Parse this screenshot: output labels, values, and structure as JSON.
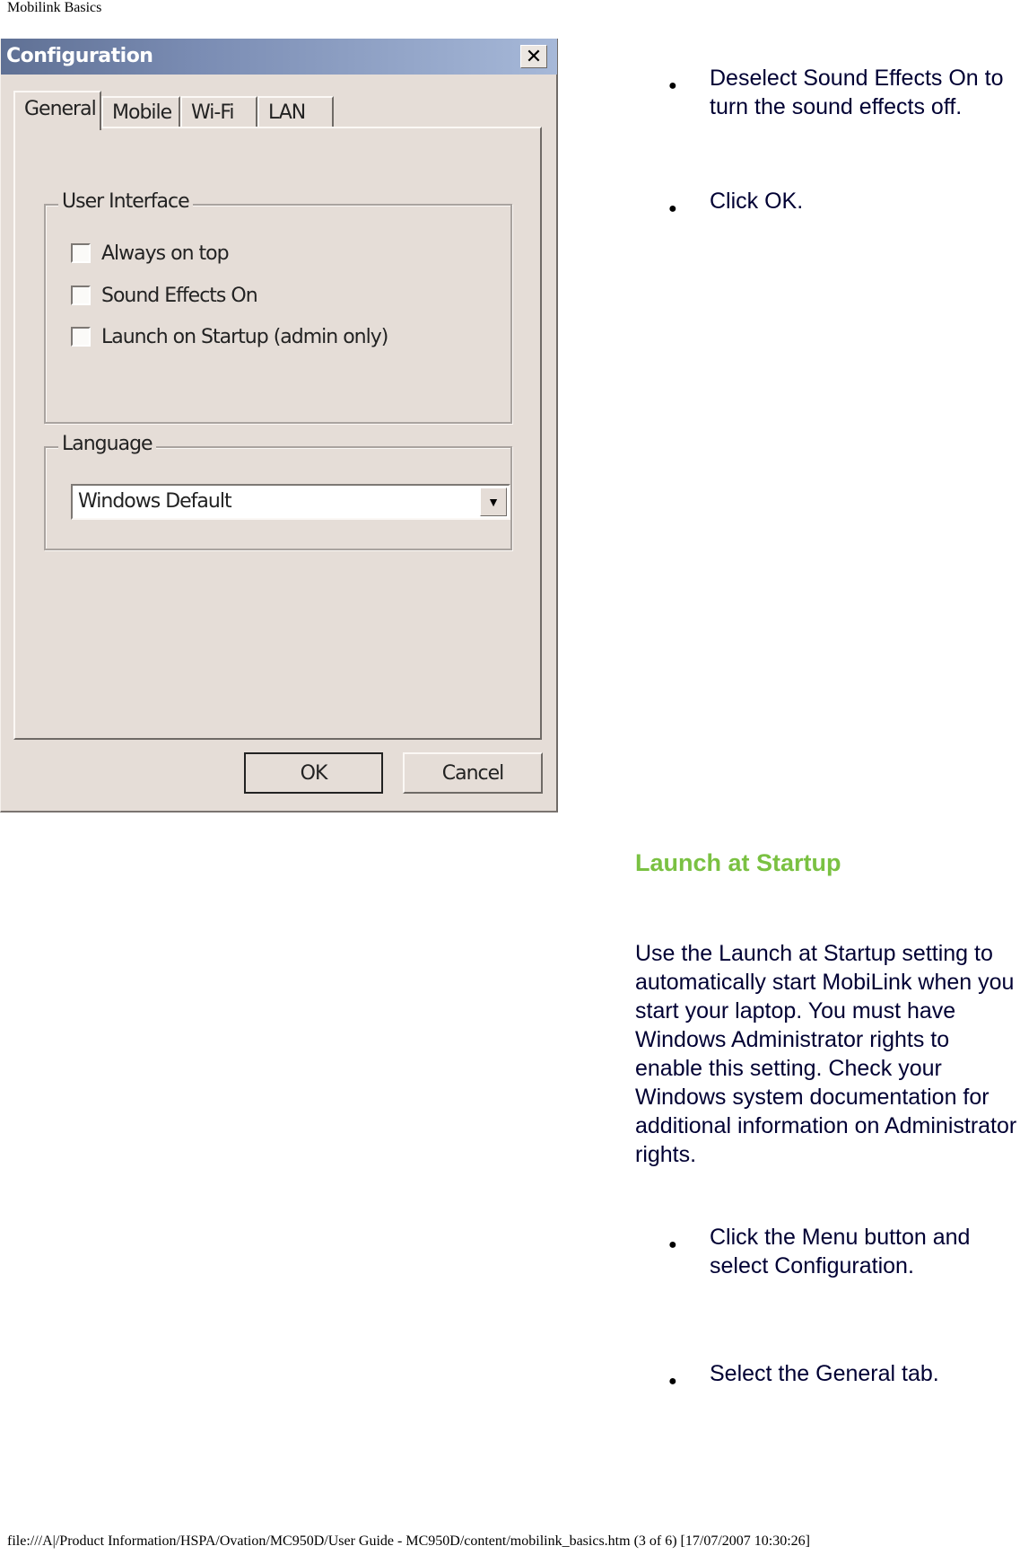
{
  "page": {
    "header": "Mobilink Basics",
    "footer": "file:///A|/Product Information/HSPA/Ovation/MC950D/User Guide - MC950D/content/mobilink_basics.htm (3 of 6) [17/07/2007 10:30:26]"
  },
  "dialog": {
    "title": "Configuration",
    "close_icon": "✕",
    "tabs": [
      {
        "label": "General",
        "active": true
      },
      {
        "label": "Mobile",
        "active": false
      },
      {
        "label": "Wi-Fi",
        "active": false
      },
      {
        "label": "LAN",
        "active": false
      }
    ],
    "user_interface": {
      "label": "User Interface",
      "options": [
        {
          "label": "Always on top",
          "checked": false
        },
        {
          "label": "Sound Effects On",
          "checked": false
        },
        {
          "label": "Launch on Startup (admin only)",
          "checked": false
        }
      ]
    },
    "language": {
      "label": "Language",
      "selected": "Windows Default",
      "dropdown_icon": "▼"
    },
    "buttons": {
      "ok": "OK",
      "cancel": "Cancel"
    }
  },
  "content": {
    "bullets_top": [
      "Deselect Sound Effects On to turn the sound effects off.",
      "Click OK."
    ],
    "section_heading": "Launch at Startup",
    "section_paragraph": "Use the Launch at Startup setting to automatically start MobiLink when you start your laptop. You must have Windows Administrator rights to enable this setting. Check your Windows system documentation for additional information on Administrator rights.",
    "bullets_bottom": [
      "Click the Menu button and select Configuration.",
      "Select the General tab."
    ],
    "bullet_glyph": "●",
    "heading_color": "#7ac142",
    "text_color": "#000033"
  }
}
